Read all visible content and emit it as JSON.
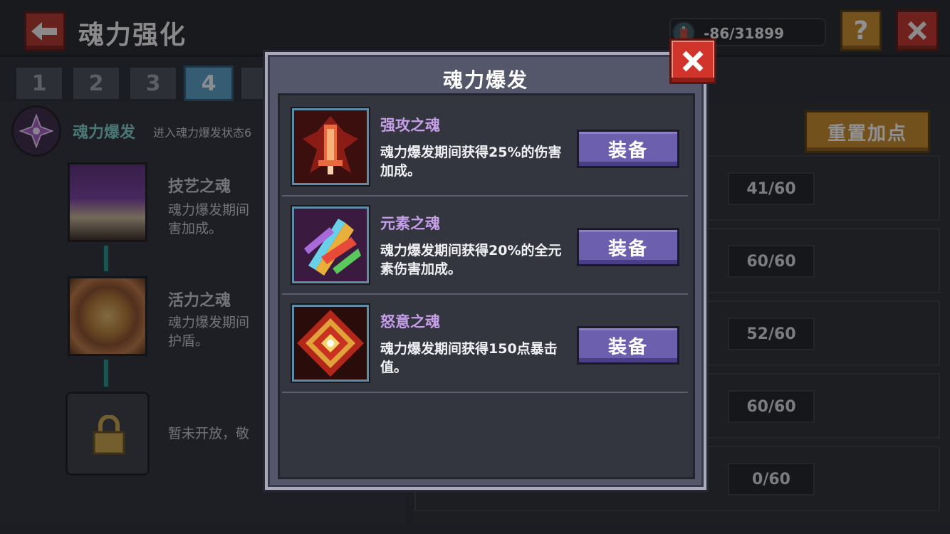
{
  "header": {
    "title": "魂力强化",
    "currency_value": "-86/31899",
    "help_label": "?"
  },
  "tabs": [
    "1",
    "2",
    "3",
    "4"
  ],
  "left": {
    "burst_title": "魂力爆发",
    "burst_desc": "进入魂力爆发状态6",
    "nodes": [
      {
        "title": "技艺之魂",
        "desc": "魂力爆发期间\n害加成。"
      },
      {
        "title": "活力之魂",
        "desc": "魂力爆发期间\n护盾。"
      },
      {
        "title": "",
        "desc": "暂未开放，敬"
      }
    ]
  },
  "right": {
    "reset_label": "重置加点",
    "values": [
      "41/60",
      "60/60",
      "52/60",
      "60/60",
      "0/60"
    ]
  },
  "modal": {
    "title": "魂力爆发",
    "items": [
      {
        "name": "强攻之魂",
        "desc": "魂力爆发期间获得25%的伤害加成。",
        "button": "装备"
      },
      {
        "name": "元素之魂",
        "desc": "魂力爆发期间获得20%的全元素伤害加成。",
        "button": "装备"
      },
      {
        "name": "怒意之魂",
        "desc": "魂力爆发期间获得150点暴击值。",
        "button": "装备"
      }
    ]
  },
  "colors": {
    "accent_purple": "#6c5fae",
    "soul_name": "#c59ee8",
    "tab_active": "#5a9ec6",
    "reset": "#c98b2b",
    "close": "#d0342a"
  }
}
